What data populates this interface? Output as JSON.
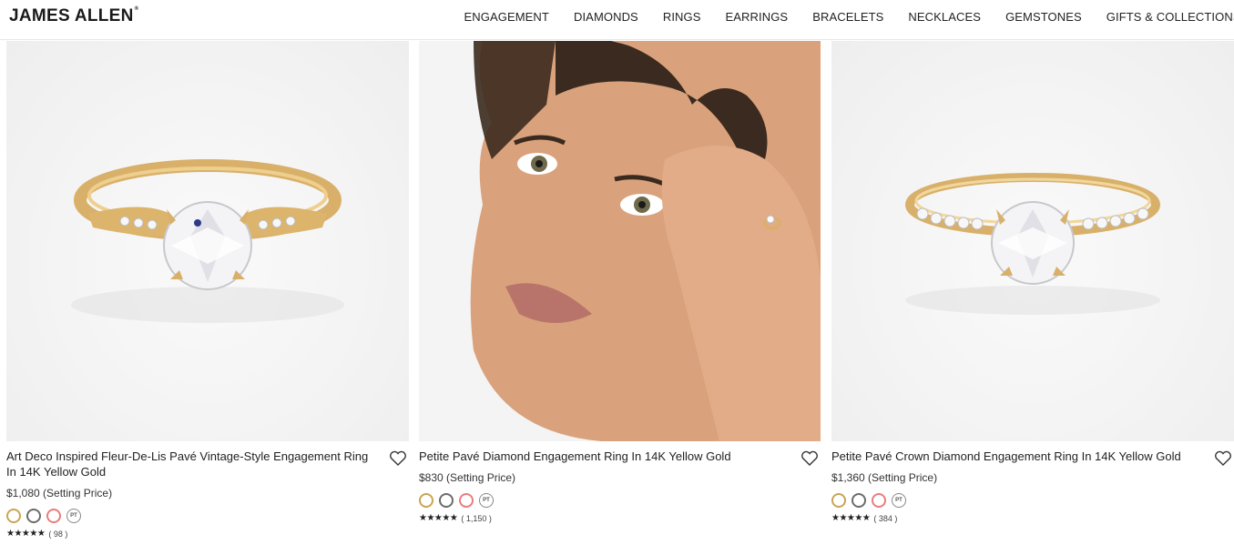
{
  "brand": {
    "name": "JAMES ALLEN",
    "mark": "®"
  },
  "nav": {
    "items": [
      "ENGAGEMENT",
      "DIAMONDS",
      "RINGS",
      "EARRINGS",
      "BRACELETS",
      "NECKLACES",
      "GEMSTONES",
      "GIFTS & COLLECTIONS"
    ]
  },
  "products": [
    {
      "title": "Art Deco Inspired Fleur-De-Lis Pavé Vintage-Style Engagement Ring In 14K Yellow Gold",
      "price": "$1,080 (Setting Price)",
      "metal_pt_label": "PT",
      "stars": "★★★★★",
      "reviews": "( 98 )",
      "image": "ring-studio"
    },
    {
      "title": "Petite Pavé Diamond Engagement Ring In 14K Yellow Gold",
      "price": "$830 (Setting Price)",
      "metal_pt_label": "PT",
      "stars": "★★★★★",
      "reviews": "( 1,150 )",
      "image": "model-wearing-ring"
    },
    {
      "title": "Petite Pavé Crown Diamond Engagement Ring In 14K Yellow Gold",
      "price": "$1,360 (Setting Price)",
      "metal_pt_label": "PT",
      "stars": "★★★★★",
      "reviews": "( 384 )",
      "image": "ring-studio"
    }
  ],
  "colors": {
    "yellow_gold": "#c9a455",
    "white_gold": "#6b6b6b",
    "rose_gold": "#ea7c7c",
    "platinum": "#888888"
  }
}
